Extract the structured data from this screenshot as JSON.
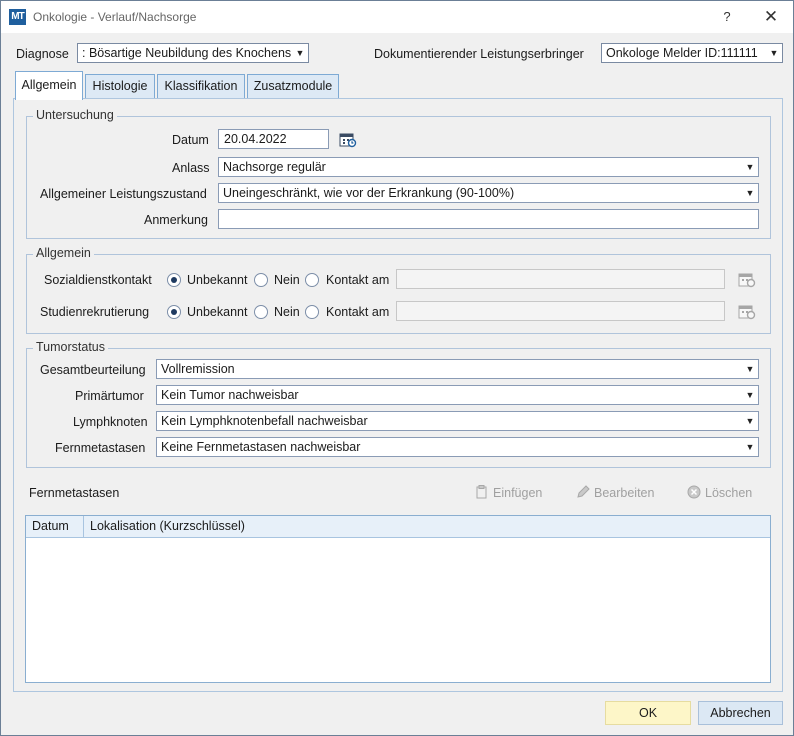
{
  "window": {
    "title": "Onkologie - Verlauf/Nachsorge",
    "app_icon_text": "MT",
    "help_label": "?",
    "close_label": "✕"
  },
  "header": {
    "diagnose_label": "Diagnose",
    "diagnose_value": ": Bösartige Neubildung des Knochens",
    "provider_label": "Dokumentierender Leistungserbringer",
    "provider_value": "Onkologe Melder ID:111111"
  },
  "tabs": [
    {
      "label": "Allgemein",
      "active": true
    },
    {
      "label": "Histologie",
      "active": false
    },
    {
      "label": "Klassifikation",
      "active": false
    },
    {
      "label": "Zusatzmodule",
      "active": false
    }
  ],
  "untersuchung": {
    "title": "Untersuchung",
    "datum_label": "Datum",
    "datum_value": "20.04.2022",
    "anlass_label": "Anlass",
    "anlass_value": "Nachsorge regulär",
    "zustand_label": "Allgemeiner Leistungszustand",
    "zustand_value": "Uneingeschränkt, wie vor der Erkrankung (90-100%)",
    "anmerkung_label": "Anmerkung",
    "anmerkung_value": ""
  },
  "allgemein": {
    "title": "Allgemein",
    "sozial_label": "Sozialdienstkontakt",
    "studien_label": "Studienrekrutierung",
    "opt_unbekannt": "Unbekannt",
    "opt_nein": "Nein",
    "opt_kontakt": "Kontakt am",
    "sozial_selected": "Unbekannt",
    "studien_selected": "Unbekannt"
  },
  "tumorstatus": {
    "title": "Tumorstatus",
    "gesamt_label": "Gesamtbeurteilung",
    "gesamt_value": "Vollremission",
    "primaer_label": "Primärtumor",
    "primaer_value": "Kein Tumor nachweisbar",
    "lymph_label": "Lymphknoten",
    "lymph_value": "Kein Lymphknotenbefall nachweisbar",
    "fern_label": "Fernmetastasen",
    "fern_value": "Keine Fernmetastasen nachweisbar"
  },
  "fernmetastasen": {
    "section_label": "Fernmetastasen",
    "einfuegen": "Einfügen",
    "bearbeiten": "Bearbeiten",
    "loeschen": "Löschen",
    "columns": [
      "Datum",
      "Lokalisation (Kurzschlüssel)"
    ],
    "rows": []
  },
  "footer": {
    "ok_label": "OK",
    "cancel_label": "Abbrechen"
  },
  "colors": {
    "accent": "#1f5f9e",
    "ok_button": "#fdf6c8",
    "cancel_button": "#dce8f4"
  }
}
